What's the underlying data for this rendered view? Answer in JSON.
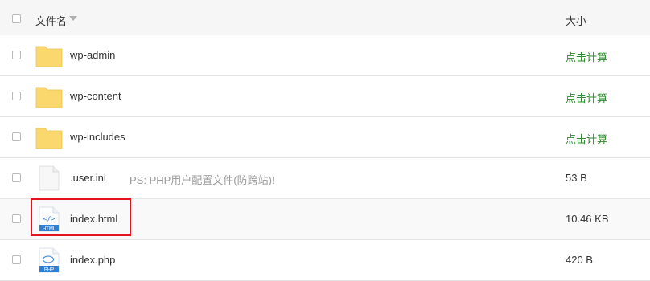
{
  "header": {
    "name_label": "文件名",
    "size_label": "大小"
  },
  "rows": [
    {
      "name": "wp-admin",
      "type": "folder",
      "size": "点击计算",
      "note": ""
    },
    {
      "name": "wp-content",
      "type": "folder",
      "size": "点击计算",
      "note": ""
    },
    {
      "name": "wp-includes",
      "type": "folder",
      "size": "点击计算",
      "note": ""
    },
    {
      "name": ".user.ini",
      "type": "file",
      "size": "53 B",
      "note": "PS: PHP用户配置文件(防跨站)!"
    },
    {
      "name": "index.html",
      "type": "html",
      "size": "10.46 KB",
      "note": "",
      "icon_text": "HTML"
    },
    {
      "name": "index.php",
      "type": "php",
      "size": "420 B",
      "note": "",
      "icon_text": "PHP"
    }
  ],
  "colors": {
    "folder": "#fbd86d",
    "calc_link": "#2e8b2e",
    "highlight": "#e3141c",
    "file_badge": "#2f7fd2"
  }
}
